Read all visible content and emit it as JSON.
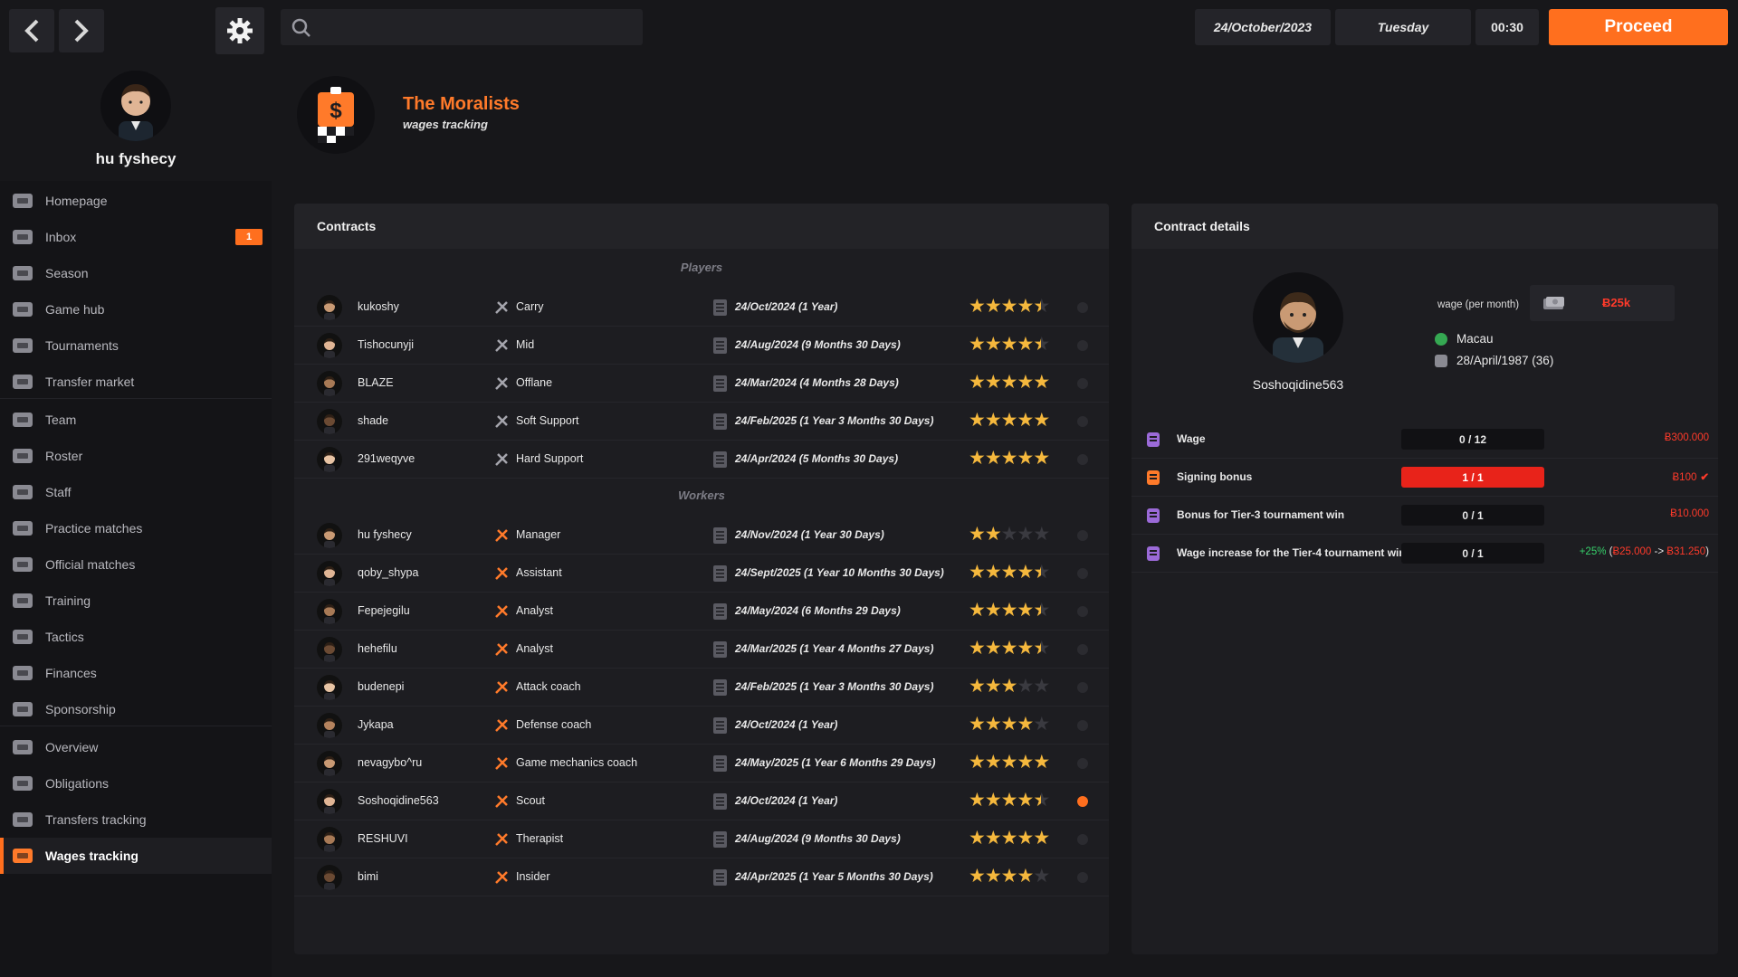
{
  "topbar": {
    "search_placeholder": "",
    "date": "24/October/2023",
    "weekday": "Tuesday",
    "time": "00:30",
    "proceed_label": "Proceed"
  },
  "profile": {
    "name": "hu fyshecy"
  },
  "sidebar": {
    "items": [
      {
        "label": "Homepage",
        "icon": "home-icon"
      },
      {
        "label": "Inbox",
        "icon": "mail-icon",
        "badge": "1"
      },
      {
        "label": "Season",
        "icon": "calendar-icon"
      },
      {
        "label": "Game hub",
        "icon": "game-hub-icon"
      },
      {
        "label": "Tournaments",
        "icon": "trophy-icon"
      },
      {
        "label": "Transfer market",
        "icon": "transfer-icon"
      },
      {
        "label": "Team",
        "icon": "team-badge-icon"
      },
      {
        "label": "Roster",
        "icon": "roster-icon"
      },
      {
        "label": "Staff",
        "icon": "staff-icon"
      },
      {
        "label": "Practice matches",
        "icon": "practice-icon"
      },
      {
        "label": "Official matches",
        "icon": "official-match-icon"
      },
      {
        "label": "Training",
        "icon": "keyboard-icon"
      },
      {
        "label": "Tactics",
        "icon": "tactics-icon"
      },
      {
        "label": "Finances",
        "icon": "money-icon"
      },
      {
        "label": "Sponsorship",
        "icon": "sponsor-icon"
      },
      {
        "label": "Overview",
        "icon": "overview-icon"
      },
      {
        "label": "Obligations",
        "icon": "obligations-icon"
      },
      {
        "label": "Transfers tracking",
        "icon": "transfers-tracking-icon"
      },
      {
        "label": "Wages tracking",
        "icon": "wages-icon"
      }
    ]
  },
  "header": {
    "team_name": "The Moralists",
    "subtitle": "wages tracking"
  },
  "contracts": {
    "title": "Contracts",
    "players_label": "Players",
    "workers_label": "Workers",
    "players": [
      {
        "name": "kukoshy",
        "role": "Carry",
        "date": "24/Oct/2024 (1 Year)",
        "stars": 4.5
      },
      {
        "name": "Tishocunyji",
        "role": "Mid",
        "date": "24/Aug/2024 (9 Months 30 Days)",
        "stars": 4.5
      },
      {
        "name": "BLAZE",
        "role": "Offlane",
        "date": "24/Mar/2024 (4 Months 28 Days)",
        "stars": 5
      },
      {
        "name": "shade",
        "role": "Soft Support",
        "date": "24/Feb/2025 (1 Year 3 Months 30 Days)",
        "stars": 5
      },
      {
        "name": "291weqyve",
        "role": "Hard Support",
        "date": "24/Apr/2024 (5 Months 30 Days)",
        "stars": 5
      }
    ],
    "workers": [
      {
        "name": "hu fyshecy",
        "role": "Manager",
        "date": "24/Nov/2024 (1 Year 30 Days)",
        "stars": 2
      },
      {
        "name": "qoby_shypa",
        "role": "Assistant",
        "date": "24/Sept/2025 (1 Year 10 Months 30 Days)",
        "stars": 4.5
      },
      {
        "name": "Fepejegilu",
        "role": "Analyst",
        "date": "24/May/2024 (6 Months 29 Days)",
        "stars": 4.5
      },
      {
        "name": "hehefilu",
        "role": "Analyst",
        "date": "24/Mar/2025 (1 Year 4 Months 27 Days)",
        "stars": 4.5
      },
      {
        "name": "budenepi",
        "role": "Attack coach",
        "date": "24/Feb/2025 (1 Year 3 Months 30 Days)",
        "stars": 3
      },
      {
        "name": "Jykapa",
        "role": "Defense coach",
        "date": "24/Oct/2024 (1 Year)",
        "stars": 4
      },
      {
        "name": "nevagybo^ru",
        "role": "Game mechanics coach",
        "date": "24/May/2025 (1 Year 6 Months 29 Days)",
        "stars": 5
      },
      {
        "name": "Soshoqidine563",
        "role": "Scout",
        "date": "24/Oct/2024 (1 Year)",
        "stars": 4.5,
        "selected": true
      },
      {
        "name": "RESHUVI",
        "role": "Therapist",
        "date": "24/Aug/2024 (9 Months 30 Days)",
        "stars": 5
      },
      {
        "name": "bimi",
        "role": "Insider",
        "date": "24/Apr/2025 (1 Year 5 Months 30 Days)",
        "stars": 4
      }
    ]
  },
  "details": {
    "title": "Contract details",
    "name": "Soshoqidine563",
    "wage_label": "wage (per month)",
    "wage_value": "Ƀ25k",
    "country": "Macau",
    "birth": "28/April/1987 (36)",
    "rows": [
      {
        "label": "Wage",
        "progress": "0 / 12",
        "value": "Ƀ300.000",
        "full": false
      },
      {
        "label": "Signing bonus",
        "progress": "1 / 1",
        "value": "Ƀ100",
        "full": true,
        "checked": true
      },
      {
        "label": "Bonus for Tier-3 tournament win",
        "progress": "0 / 1",
        "value": "Ƀ10.000",
        "full": false
      },
      {
        "label": "Wage increase for the Tier-4 tournament win",
        "progress": "0 / 1",
        "value_pct": "+25%",
        "value_from": "Ƀ25.000",
        "value_arrow": "->",
        "value_to": "Ƀ31.250",
        "full": false
      }
    ]
  },
  "colors": {
    "accent": "#ff6f1e",
    "star": "#f5b83d",
    "negative": "#ff3a2a",
    "positive": "#37d16b"
  }
}
